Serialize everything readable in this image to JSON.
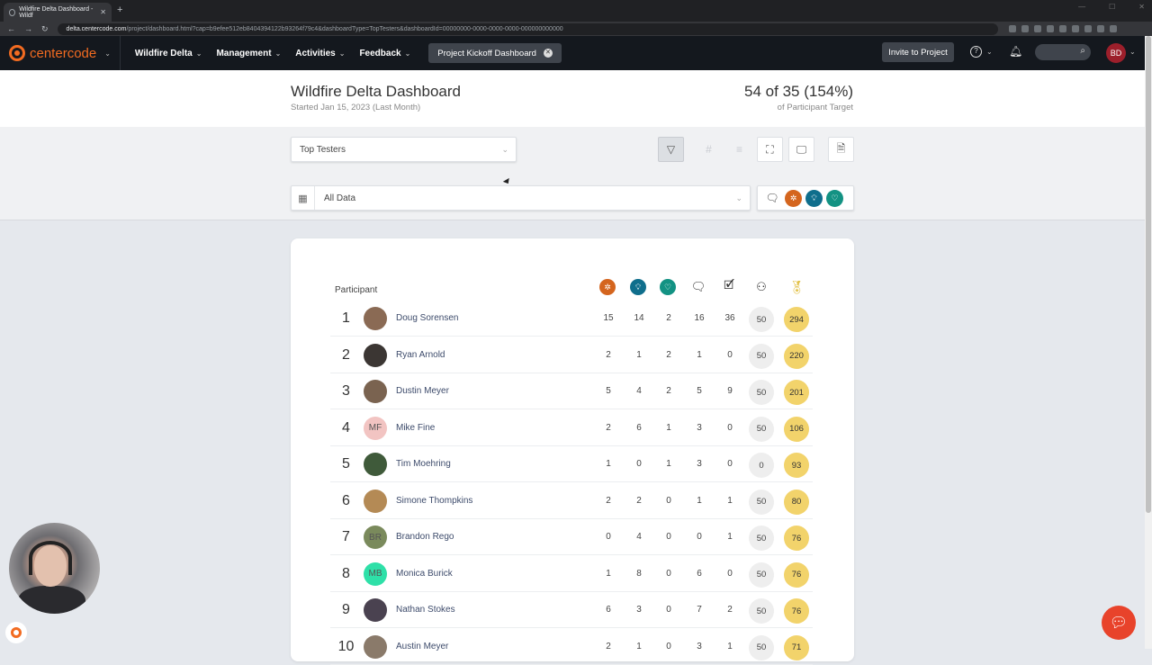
{
  "browser": {
    "tab_title": "Wildfire Delta Dashboard - Wildf",
    "url_domain": "delta.centercode.com",
    "url_path": "/project/dashboard.html?cap=b9efee512eb8404394122b93264f79c4&dashboardType=TopTesters&dashboardId=00000000-0000-0000-0000-000000000000"
  },
  "nav": {
    "brand": "centercode",
    "items": [
      "Wildfire Delta",
      "Management",
      "Activities",
      "Feedback"
    ],
    "active_dashboard": "Project Kickoff Dashboard",
    "invite": "Invite to Project",
    "user_initials": "BD"
  },
  "header": {
    "title": "Wildfire Delta Dashboard",
    "subtitle": "Started Jan 15, 2023 (Last Month)",
    "target": "54 of 35 (154%)",
    "target_label": "of Participant Target"
  },
  "filters": {
    "dashboard_select": "Top Testers",
    "date_select": "All Data"
  },
  "table": {
    "column_participant": "Participant",
    "colors": {
      "issue": "#d4651e",
      "idea": "#0f6e8c",
      "praise": "#139283",
      "gold": "#f2d36b"
    },
    "rows": [
      {
        "rank": "1",
        "name": "Doug Sorensen",
        "initials": "",
        "ava_bg": "#8a6a54",
        "v": [
          "15",
          "14",
          "2",
          "16",
          "36"
        ],
        "grey": "50",
        "score": "294"
      },
      {
        "rank": "2",
        "name": "Ryan Arnold",
        "initials": "",
        "ava_bg": "#3b3633",
        "v": [
          "2",
          "1",
          "2",
          "1",
          "0"
        ],
        "grey": "50",
        "score": "220"
      },
      {
        "rank": "3",
        "name": "Dustin Meyer",
        "initials": "",
        "ava_bg": "#7a6350",
        "v": [
          "5",
          "4",
          "2",
          "5",
          "9"
        ],
        "grey": "50",
        "score": "201"
      },
      {
        "rank": "4",
        "name": "Mike Fine",
        "initials": "MF",
        "ava_bg": "#f2c4c2",
        "v": [
          "2",
          "6",
          "1",
          "3",
          "0"
        ],
        "grey": "50",
        "score": "106"
      },
      {
        "rank": "5",
        "name": "Tim Moehring",
        "initials": "",
        "ava_bg": "#3f5a3a",
        "v": [
          "1",
          "0",
          "1",
          "3",
          "0"
        ],
        "grey": "0",
        "score": "93"
      },
      {
        "rank": "6",
        "name": "Simone Thompkins",
        "initials": "",
        "ava_bg": "#b48a55",
        "v": [
          "2",
          "2",
          "0",
          "1",
          "1"
        ],
        "grey": "50",
        "score": "80"
      },
      {
        "rank": "7",
        "name": "Brandon Rego",
        "initials": "BR",
        "ava_bg": "#7a8a5c",
        "v": [
          "0",
          "4",
          "0",
          "0",
          "1"
        ],
        "grey": "50",
        "score": "76"
      },
      {
        "rank": "8",
        "name": "Monica Burick",
        "initials": "MB",
        "ava_bg": "#2ee0a8",
        "v": [
          "1",
          "8",
          "0",
          "6",
          "0"
        ],
        "grey": "50",
        "score": "76"
      },
      {
        "rank": "9",
        "name": "Nathan Stokes",
        "initials": "",
        "ava_bg": "#4a4250",
        "v": [
          "6",
          "3",
          "0",
          "7",
          "2"
        ],
        "grey": "50",
        "score": "76"
      },
      {
        "rank": "10",
        "name": "Austin Meyer",
        "initials": "",
        "ava_bg": "#8a7a6a",
        "v": [
          "2",
          "1",
          "0",
          "3",
          "1"
        ],
        "grey": "50",
        "score": "71"
      }
    ]
  }
}
